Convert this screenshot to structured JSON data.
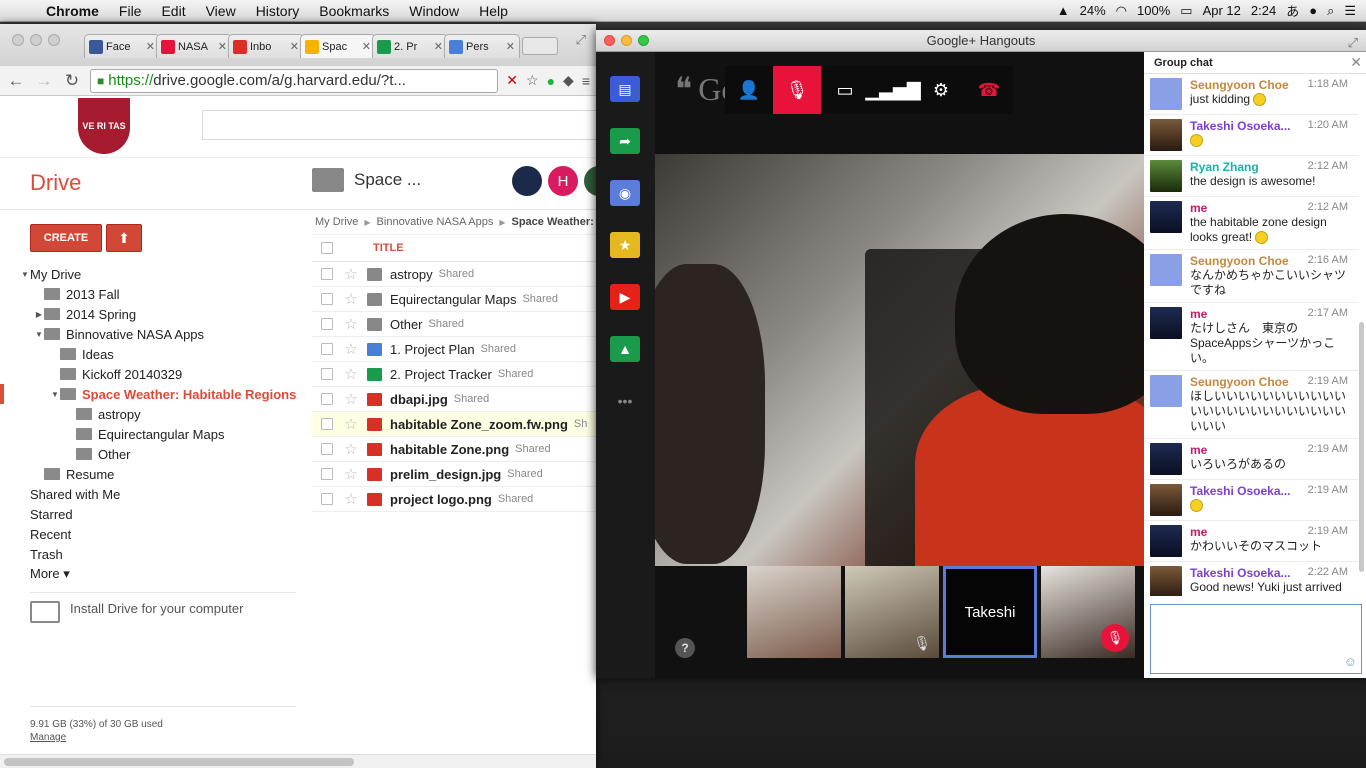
{
  "menubar": {
    "app": "Chrome",
    "items": [
      "File",
      "Edit",
      "View",
      "History",
      "Bookmarks",
      "Window",
      "Help"
    ],
    "battery": "24%",
    "battery2": "100%",
    "date": "Apr 12",
    "time": "2:24",
    "ime": "あ"
  },
  "chrome": {
    "tabs": [
      {
        "label": "Face",
        "color": "#3b5998"
      },
      {
        "label": "NASA",
        "color": "#e8133a"
      },
      {
        "label": "Inbo",
        "color": "#d93025"
      },
      {
        "label": "Spac",
        "color": "#f4b400"
      },
      {
        "label": "2. Pr",
        "color": "#1a9b4b"
      },
      {
        "label": "Pers",
        "color": "#4a7fd8"
      }
    ],
    "url_https": "https://",
    "url_rest": "drive.google.com/a/g.harvard.edu/?t..."
  },
  "drive": {
    "crest_text": "VE RI TAS",
    "title": "Drive",
    "create_label": "CREATE",
    "upload_icon": "⬆",
    "folder_title": "Space ...",
    "avatar_h": "H",
    "tree": [
      {
        "label": "My Drive",
        "indent": 20,
        "arrow": "▼",
        "icon": false,
        "sel": false
      },
      {
        "label": "2013 Fall",
        "indent": 44,
        "arrow": "",
        "icon": true,
        "sel": false
      },
      {
        "label": "2014 Spring",
        "indent": 34,
        "arrow": "▶",
        "icon": true,
        "sel": false
      },
      {
        "label": "Binnovative NASA Apps",
        "indent": 34,
        "arrow": "▼",
        "icon": true,
        "sel": false
      },
      {
        "label": "Ideas",
        "indent": 60,
        "arrow": "",
        "icon": true,
        "sel": false
      },
      {
        "label": "Kickoff 20140329",
        "indent": 60,
        "arrow": "",
        "icon": true,
        "sel": false
      },
      {
        "label": "Space Weather: Habitable Regions",
        "indent": 50,
        "arrow": "▼",
        "icon": true,
        "sel": true
      },
      {
        "label": "astropy",
        "indent": 76,
        "arrow": "",
        "icon": true,
        "sel": false
      },
      {
        "label": "Equirectangular Maps",
        "indent": 76,
        "arrow": "",
        "icon": true,
        "sel": false
      },
      {
        "label": "Other",
        "indent": 76,
        "arrow": "",
        "icon": true,
        "sel": false
      },
      {
        "label": "Resume",
        "indent": 44,
        "arrow": "",
        "icon": true,
        "sel": false
      }
    ],
    "nav_items": [
      "Shared with Me",
      "Starred",
      "Recent",
      "Trash",
      "More ▾"
    ],
    "install_label": "Install Drive for your computer",
    "quota": "9.91 GB (33%) of 30 GB used",
    "manage": "Manage",
    "breadcrumb": [
      "My Drive",
      "Binnovative NASA Apps"
    ],
    "breadcrumb_last": "Space Weather:",
    "col_title": "TITLE",
    "files": [
      {
        "name": "astropy",
        "type": "fold",
        "shared": "Shared",
        "bold": false,
        "hl": false
      },
      {
        "name": "Equirectangular Maps",
        "type": "fold",
        "shared": "Shared",
        "bold": false,
        "hl": false
      },
      {
        "name": "Other",
        "type": "fold",
        "shared": "Shared",
        "bold": false,
        "hl": false
      },
      {
        "name": "1. Project Plan",
        "type": "doc",
        "shared": "Shared",
        "bold": false,
        "hl": false
      },
      {
        "name": "2. Project Tracker",
        "type": "sheet",
        "shared": "Shared",
        "bold": false,
        "hl": false
      },
      {
        "name": "dbapi.jpg",
        "type": "img",
        "shared": "Shared",
        "bold": true,
        "hl": false
      },
      {
        "name": "habitable Zone_zoom.fw.png",
        "type": "img",
        "shared": "Sh",
        "bold": true,
        "hl": true
      },
      {
        "name": "habitable Zone.png",
        "type": "img",
        "shared": "Shared",
        "bold": true,
        "hl": false
      },
      {
        "name": "prelim_design.jpg",
        "type": "img",
        "shared": "Shared",
        "bold": true,
        "hl": false
      },
      {
        "name": "project logo.png",
        "type": "img",
        "shared": "Shared",
        "bold": true,
        "hl": false
      }
    ]
  },
  "hangouts": {
    "window_title": "Google+ Hangouts",
    "brand_partial": "Goo",
    "thumb_name": "Takeshi",
    "help": "?",
    "chat_title": "Group chat",
    "messages": [
      {
        "name": "Seungyoon Choe",
        "time": "1:18 AM",
        "text": "just kidding",
        "emoji": true,
        "color": "#c5873b",
        "pic": "silh"
      },
      {
        "name": "Takeshi Osoeka...",
        "time": "1:20 AM",
        "text": "",
        "emoji": true,
        "color": "#7b3fd1",
        "pic": "photo"
      },
      {
        "name": "Ryan Zhang",
        "time": "2:12 AM",
        "text": "the design is awesome!",
        "emoji": false,
        "color": "#1ab0b0",
        "pic": "green"
      },
      {
        "name": "me",
        "time": "2:12 AM",
        "text": "the habitable zone design looks great!",
        "emoji": true,
        "color": "#c71a6a",
        "pic": "night"
      },
      {
        "name": "Seungyoon Choe",
        "time": "2:16 AM",
        "text": "なんかめちゃかこいいシャツですね",
        "emoji": false,
        "color": "#c5873b",
        "pic": "silh"
      },
      {
        "name": "me",
        "time": "2:17 AM",
        "text": "たけしさん　東京のSpaceAppsシャーツかっこい。",
        "emoji": false,
        "color": "#c71a6a",
        "pic": "night"
      },
      {
        "name": "Seungyoon Choe",
        "time": "2:19 AM",
        "text": "ほしいいいいいいいいいいいいいいいいいいいいいいいいいいい",
        "emoji": false,
        "color": "#c5873b",
        "pic": "silh"
      },
      {
        "name": "me",
        "time": "2:19 AM",
        "text": "いろいろがあるの",
        "emoji": false,
        "color": "#c71a6a",
        "pic": "night"
      },
      {
        "name": "Takeshi Osoeka...",
        "time": "2:19 AM",
        "text": "",
        "emoji": true,
        "color": "#7b3fd1",
        "pic": "photo"
      },
      {
        "name": "me",
        "time": "2:19 AM",
        "text": "かわいいそのマスコット",
        "emoji": false,
        "color": "#c71a6a",
        "pic": "night"
      },
      {
        "name": "Takeshi Osoeka...",
        "time": "2:22 AM",
        "text": "Good news! Yuki just arrived to the",
        "emoji": false,
        "color": "#7b3fd1",
        "pic": "photo"
      }
    ]
  }
}
